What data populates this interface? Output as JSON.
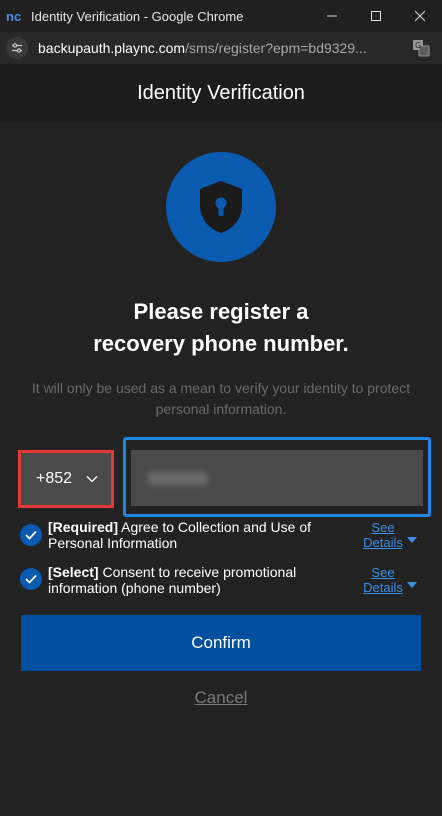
{
  "window": {
    "title": "Identity Verification - Google Chrome",
    "logo_text": "nc",
    "url_host": "backupauth.plaync.com",
    "url_path": "/sms/register?epm=bd9329..."
  },
  "header": {
    "title": "Identity Verification"
  },
  "main": {
    "heading_line1": "Please register a",
    "heading_line2": "recovery phone number.",
    "subtext": "It will only be used as a mean to verify your identity to protect personal information.",
    "country_code": "+852",
    "phone_value": "",
    "agreements": [
      {
        "tag": "[Required]",
        "text": " Agree to Collection and Use of Personal Information",
        "link_line1": "See",
        "link_line2": "Details",
        "checked": true
      },
      {
        "tag": "[Select]",
        "text": " Consent to receive promotional information (phone number)",
        "link_line1": "See",
        "link_line2": "Details",
        "checked": true
      }
    ],
    "confirm_label": "Confirm",
    "cancel_label": "Cancel"
  },
  "colors": {
    "accent": "#0a5bb0",
    "confirm_bg": "#0050a0",
    "link": "#3b8fe8",
    "highlight_red": "#e53935",
    "highlight_blue": "#1e88e5"
  },
  "icons": [
    "nc-logo-icon",
    "minimize-icon",
    "maximize-icon",
    "close-icon",
    "site-info-icon",
    "translate-icon",
    "shield-lock-icon",
    "chevron-down-icon",
    "check-icon",
    "dropdown-arrow-icon"
  ]
}
